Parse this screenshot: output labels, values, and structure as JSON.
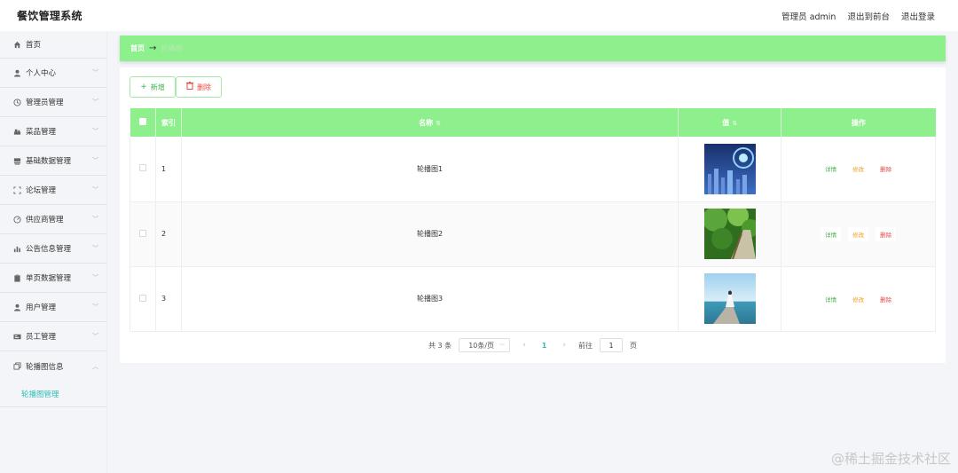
{
  "header": {
    "brand": "餐饮管理系统",
    "admin_label": "管理员 admin",
    "to_front": "退出到前台",
    "logout": "退出登录"
  },
  "sidebar": {
    "items": [
      {
        "label": "首页",
        "icon": "home-icon"
      },
      {
        "label": "个人中心",
        "icon": "user-icon"
      },
      {
        "label": "管理员管理",
        "icon": "clock-icon"
      },
      {
        "label": "菜品管理",
        "icon": "dish-icon"
      },
      {
        "label": "基础数据管理",
        "icon": "database-icon"
      },
      {
        "label": "论坛管理",
        "icon": "frame-icon"
      },
      {
        "label": "供应商管理",
        "icon": "gauge-icon"
      },
      {
        "label": "公告信息管理",
        "icon": "bar-chart-icon"
      },
      {
        "label": "单页数据管理",
        "icon": "clipboard-icon"
      },
      {
        "label": "用户管理",
        "icon": "user-icon"
      },
      {
        "label": "员工管理",
        "icon": "id-card-icon"
      },
      {
        "label": "轮播图信息",
        "icon": "copy-icon"
      }
    ],
    "submenu": "轮播图管理"
  },
  "breadcrumb": {
    "home": "首页",
    "separator": "→",
    "current": "轮播图"
  },
  "toolbar": {
    "add_label": "新增",
    "delete_label": "删除"
  },
  "table": {
    "headers": {
      "index": "索引",
      "name": "名称",
      "value": "值",
      "actions": "操作"
    },
    "rows": [
      {
        "index": "1",
        "name": "轮播图1"
      },
      {
        "index": "2",
        "name": "轮播图2"
      },
      {
        "index": "3",
        "name": "轮播图3"
      }
    ],
    "actions": {
      "detail": "详情",
      "edit": "修改",
      "delete": "删除"
    }
  },
  "pagination": {
    "total": "共 3 条",
    "page_size": "10条/页",
    "current_page": "1",
    "goto_label": "前往",
    "goto_value": "1",
    "page_unit": "页"
  },
  "watermark": "@稀土掘金技术社区",
  "colors": {
    "accent_green": "#8ef08c",
    "teal": "#2fbdb8",
    "danger": "#e04848",
    "warning": "#f0a020"
  }
}
